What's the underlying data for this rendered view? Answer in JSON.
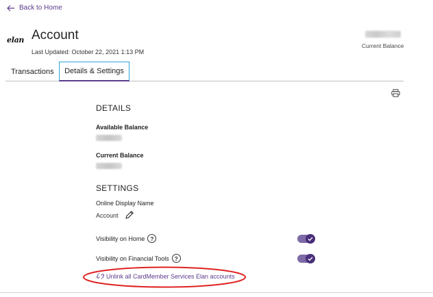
{
  "nav": {
    "back_label": "Back to Home"
  },
  "header": {
    "logo_text": "elan",
    "title": "Account",
    "last_updated": "Last Updated: October 22, 2021 1:13 PM",
    "current_balance_label": "Current Balance"
  },
  "tabs": [
    {
      "label": "Transactions",
      "active": false
    },
    {
      "label": "Details & Settings",
      "active": true
    }
  ],
  "details": {
    "heading": "DETAILS",
    "available_balance_label": "Available Balance",
    "current_balance_label": "Current Balance"
  },
  "settings": {
    "heading": "SETTINGS",
    "display_name_label": "Online Display Name",
    "display_name_value": "Account",
    "visibility_home_label": "Visibility on Home",
    "visibility_home_on": true,
    "visibility_tools_label": "Visibility on Financial Tools",
    "visibility_tools_on": true,
    "unlink_label": "Unlink all CardMember Services Elan accounts"
  },
  "colors": {
    "accent": "#5a3a8c",
    "tab_focus": "#2fa0d8",
    "annotation": "#e02020"
  }
}
